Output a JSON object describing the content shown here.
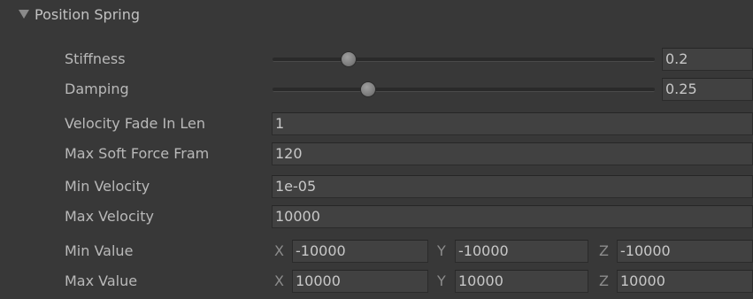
{
  "foldout": {
    "label": "Position Spring"
  },
  "stiffness": {
    "label": "Stiffness",
    "value": "0.2",
    "slider_fraction": 0.2
  },
  "damping": {
    "label": "Damping",
    "value": "0.25",
    "slider_fraction": 0.25
  },
  "velocity_fade": {
    "label": "Velocity Fade In Len",
    "value": "1"
  },
  "max_soft_force": {
    "label": "Max Soft Force Fram",
    "value": "120"
  },
  "min_velocity": {
    "label": "Min Velocity",
    "value": "1e-05"
  },
  "max_velocity": {
    "label": "Max Velocity",
    "value": "10000"
  },
  "min_value": {
    "label": "Min Value",
    "x_label": "X",
    "x": "-10000",
    "y_label": "Y",
    "y": "-10000",
    "z_label": "Z",
    "z": "-10000"
  },
  "max_value": {
    "label": "Max Value",
    "x_label": "X",
    "x": "10000",
    "y_label": "Y",
    "y": "10000",
    "z_label": "Z",
    "z": "10000"
  }
}
